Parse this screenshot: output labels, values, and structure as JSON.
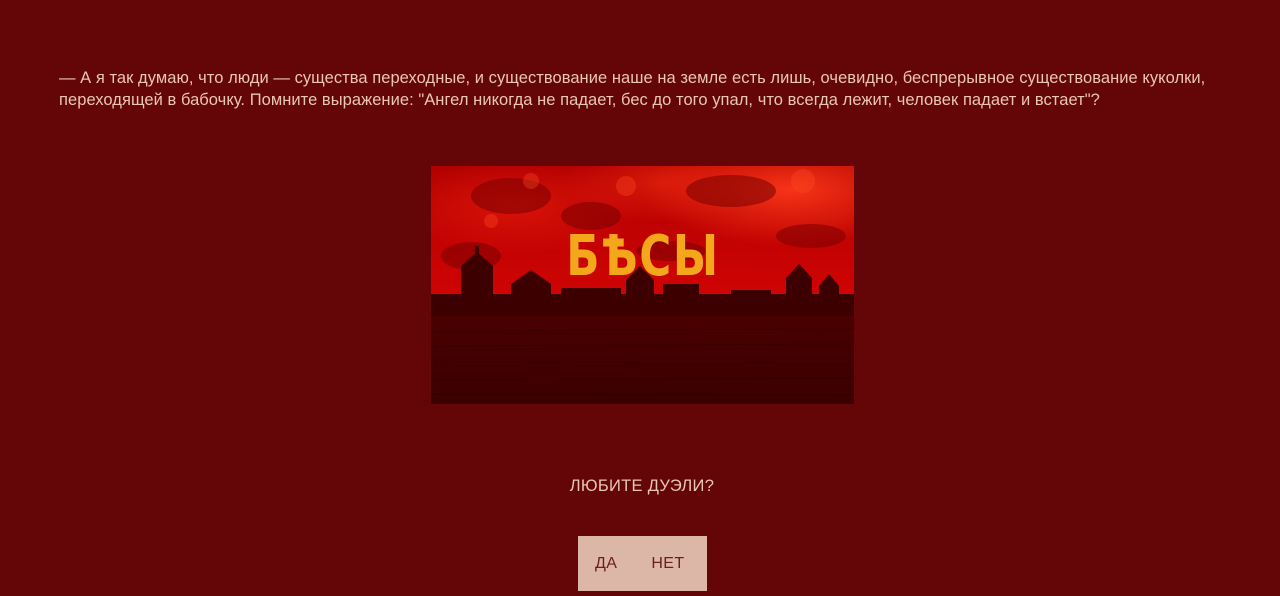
{
  "quote": {
    "text": "— А я так думаю, что люди — существа переходные, и существование наше на земле есть лишь, очевидно, беспрерывное существование куколки, переходящей в бабочку. Помните выражение: \"Ангел никогда не падает, бес до того упал, что всегда лежит, человек падает и встает\"?"
  },
  "poster": {
    "title": "БѢСЫ",
    "title_color": "#f5a71c"
  },
  "poll": {
    "question": "ЛЮБИТЕ ДУЭЛИ?",
    "yes_label": "ДА",
    "no_label": "НЕТ"
  },
  "colors": {
    "background": "#640607",
    "text": "#e9c6b6",
    "button_bg": "#dcb7a7",
    "button_text": "#6a1f1a"
  }
}
